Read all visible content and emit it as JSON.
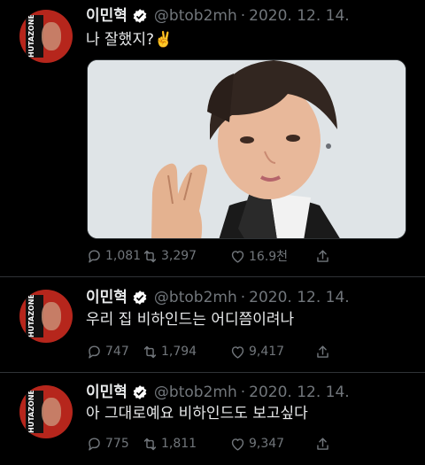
{
  "colors": {
    "background": "#000000",
    "text": "#e7e9ea",
    "muted": "#71767b",
    "verified": "#ffffff",
    "avatar_bg": "#b6261c"
  },
  "tweets": [
    {
      "name": "이민혁",
      "handle": "@btob2mh",
      "separator": "·",
      "date": "2020. 12. 14.",
      "text": "나 잘했지?✌️",
      "avatar_text": "HUTAZONE",
      "has_image": true,
      "replies": "1,081",
      "retweets": "3,297",
      "likes": "16.9천"
    },
    {
      "name": "이민혁",
      "handle": "@btob2mh",
      "separator": "·",
      "date": "2020. 12. 14.",
      "text": "우리 집 비하인드는 어디쯤이려나",
      "avatar_text": "HUTAZONE",
      "has_image": false,
      "replies": "747",
      "retweets": "1,794",
      "likes": "9,417"
    },
    {
      "name": "이민혁",
      "handle": "@btob2mh",
      "separator": "·",
      "date": "2020. 12. 14.",
      "text": "아 그대로예요 비하인드도 보고싶다",
      "avatar_text": "HUTAZONE",
      "has_image": false,
      "replies": "775",
      "retweets": "1,811",
      "likes": "9,347"
    }
  ]
}
